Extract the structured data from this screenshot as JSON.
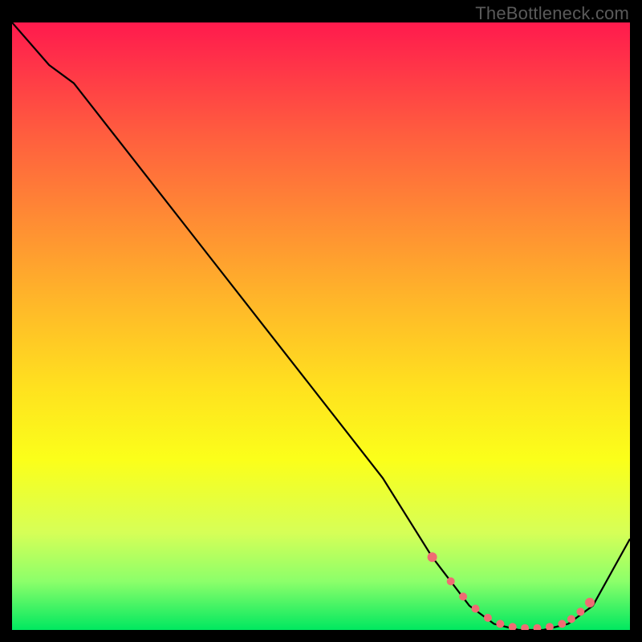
{
  "watermark": "TheBottleneck.com",
  "chart_data": {
    "type": "line",
    "title": "",
    "xlabel": "",
    "ylabel": "",
    "xlim": [
      0,
      100
    ],
    "ylim": [
      0,
      100
    ],
    "series": [
      {
        "name": "bottleneck-curve",
        "x": [
          0,
          6,
          10,
          20,
          30,
          40,
          50,
          60,
          68,
          74,
          78,
          82,
          86,
          90,
          94,
          100
        ],
        "y": [
          100,
          93,
          90,
          77,
          64,
          51,
          38,
          25,
          12,
          4,
          1,
          0,
          0,
          1,
          4,
          15
        ]
      }
    ],
    "markers": {
      "name": "optimal-range-dots",
      "color": "#ef6c73",
      "x": [
        68,
        71,
        73,
        75,
        77,
        79,
        81,
        83,
        85,
        87,
        89,
        90.5,
        92,
        93.5
      ],
      "y": [
        12,
        8,
        5.5,
        3.5,
        2,
        1,
        0.5,
        0.3,
        0.3,
        0.5,
        1,
        1.8,
        3,
        4.5
      ]
    }
  }
}
